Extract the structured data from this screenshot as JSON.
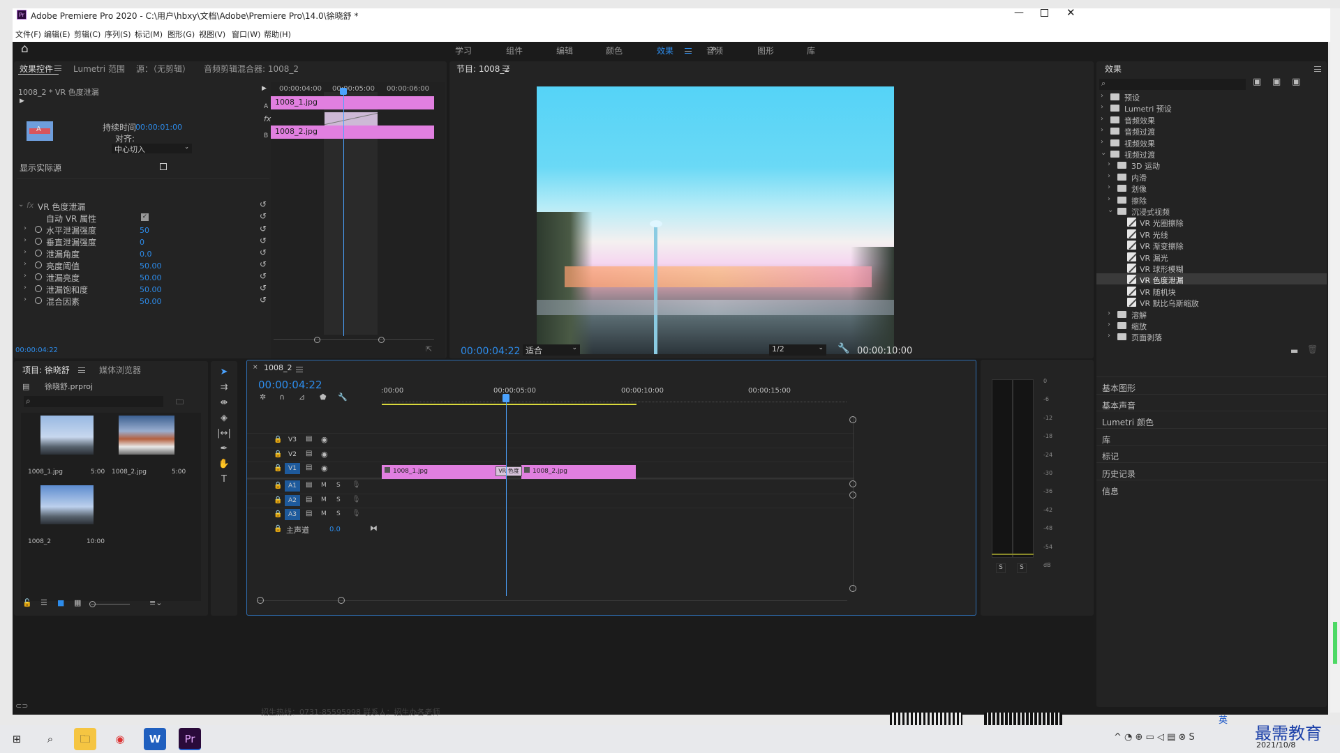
{
  "window": {
    "title": "Adobe Premiere Pro 2020 - C:\\用户\\hbxy\\文档\\Adobe\\Premiere Pro\\14.0\\徐晓舒 *",
    "app_icon": "Pr"
  },
  "menu": [
    "文件(F)",
    "编辑(E)",
    "剪辑(C)",
    "序列(S)",
    "标记(M)",
    "图形(G)",
    "视图(V)",
    "窗口(W)",
    "帮助(H)"
  ],
  "workspaces": [
    "学习",
    "组件",
    "编辑",
    "颜色",
    "效果",
    "音频",
    "图形",
    "库"
  ],
  "active_workspace": "效果",
  "effect_controls": {
    "tabs": [
      "效果控件",
      "Lumetri 范围",
      "源：（无剪辑）",
      "音频剪辑混合器: 1008_2"
    ],
    "header": "1008_2 * VR 色度泄漏",
    "duration_label": "持续时间",
    "duration_value": "00:00:01:00",
    "align_label": "对齐:",
    "align_value": "中心切入",
    "show_actual_sources": "显示实际源",
    "effect_name": "VR 色度泄漏",
    "auto_vr_label": "自动 VR 属性",
    "params": [
      {
        "name": "水平泄漏强度",
        "value": "50"
      },
      {
        "name": "垂直泄漏强度",
        "value": "0"
      },
      {
        "name": "泄漏角度",
        "value": "0.0"
      },
      {
        "name": "亮度阈值",
        "value": "50.00"
      },
      {
        "name": "泄漏亮度",
        "value": "50.00"
      },
      {
        "name": "泄漏饱和度",
        "value": "50.00"
      },
      {
        "name": "混合因素",
        "value": "50.00"
      }
    ],
    "mini_ruler": [
      "00:00:04:00",
      "00:00:05:00",
      "00:00:06:00"
    ],
    "track_a": "A",
    "track_b": "B",
    "fx_label": "fx",
    "clip_a": "1008_1.jpg",
    "clip_b": "1008_2.jpg",
    "timecode": "00:00:04:22"
  },
  "program": {
    "title": "节目: 1008_2",
    "timecode": "00:00:04:22",
    "fit": "适合",
    "resolution": "1/2",
    "duration": "00:00:10:00"
  },
  "effects": {
    "title": "效果",
    "tree": [
      {
        "label": "预设",
        "level": 0,
        "open": false,
        "kind": "folder"
      },
      {
        "label": "Lumetri 预设",
        "level": 0,
        "open": false,
        "kind": "folder"
      },
      {
        "label": "音频效果",
        "level": 0,
        "open": false,
        "kind": "folder"
      },
      {
        "label": "音频过渡",
        "level": 0,
        "open": false,
        "kind": "folder"
      },
      {
        "label": "视频效果",
        "level": 0,
        "open": false,
        "kind": "folder"
      },
      {
        "label": "视频过渡",
        "level": 0,
        "open": true,
        "kind": "folder"
      },
      {
        "label": "3D 运动",
        "level": 1,
        "open": false,
        "kind": "folder"
      },
      {
        "label": "内滑",
        "level": 1,
        "open": false,
        "kind": "folder"
      },
      {
        "label": "划像",
        "level": 1,
        "open": false,
        "kind": "folder"
      },
      {
        "label": "擦除",
        "level": 1,
        "open": false,
        "kind": "folder"
      },
      {
        "label": "沉浸式视频",
        "level": 1,
        "open": true,
        "kind": "folder"
      },
      {
        "label": "VR 光圈擦除",
        "level": 2,
        "kind": "fx"
      },
      {
        "label": "VR 光线",
        "level": 2,
        "kind": "fx"
      },
      {
        "label": "VR 渐变擦除",
        "level": 2,
        "kind": "fx"
      },
      {
        "label": "VR 漏光",
        "level": 2,
        "kind": "fx"
      },
      {
        "label": "VR 球形模糊",
        "level": 2,
        "kind": "fx"
      },
      {
        "label": "VR 色度泄漏",
        "level": 2,
        "kind": "fx",
        "selected": true
      },
      {
        "label": "VR 随机块",
        "level": 2,
        "kind": "fx"
      },
      {
        "label": "VR 默比乌斯缩放",
        "level": 2,
        "kind": "fx"
      },
      {
        "label": "溶解",
        "level": 1,
        "open": false,
        "kind": "folder"
      },
      {
        "label": "缩放",
        "level": 1,
        "open": false,
        "kind": "folder"
      },
      {
        "label": "页面剥落",
        "level": 1,
        "open": false,
        "kind": "folder"
      }
    ],
    "sections": [
      "基本图形",
      "基本声音",
      "Lumetri 颜色",
      "库",
      "标记",
      "历史记录",
      "信息"
    ]
  },
  "project": {
    "tabs": [
      "项目: 徐晓舒",
      "媒体浏览器"
    ],
    "file": "徐晓舒.prproj",
    "items": [
      {
        "name": "1008_1.jpg",
        "dur": "5:00"
      },
      {
        "name": "1008_2.jpg",
        "dur": "5:00"
      },
      {
        "name": "1008_2",
        "dur": "10:00"
      }
    ]
  },
  "timeline": {
    "tab": "1008_2",
    "timecode": "00:00:04:22",
    "ruler": [
      ":00:00",
      "00:00:05:00",
      "00:00:10:00",
      "00:00:15:00"
    ],
    "video_tracks": [
      "V3",
      "V2",
      "V1"
    ],
    "audio_tracks": [
      "A1",
      "A2",
      "A3"
    ],
    "master": "主声道",
    "master_value": "0.0",
    "clip1": "1008_1.jpg",
    "clip2": "1008_2.jpg",
    "transition": "VR 色度"
  },
  "meter": {
    "scale": [
      "0",
      "-6",
      "-12",
      "-18",
      "-24",
      "-30",
      "-36",
      "-42",
      "-48",
      "-54",
      "dB"
    ],
    "solo": [
      "S",
      "S"
    ]
  },
  "ticker": "招生热线：0731-85595998 联系人：招生办各老师",
  "taskbar": {
    "clock": "2021/10/8",
    "ime": "英",
    "watermark": "最需教育"
  }
}
